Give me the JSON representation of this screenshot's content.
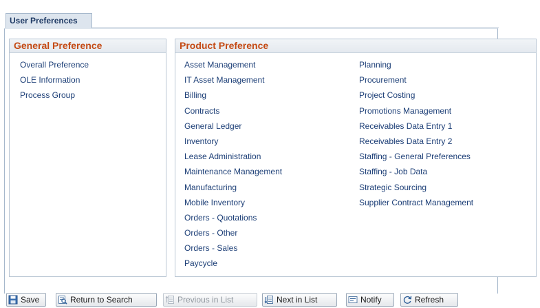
{
  "tab": {
    "label": "User Preferences"
  },
  "general": {
    "title": "General Preference",
    "links": [
      "Overall Preference",
      "OLE Information",
      "Process Group"
    ]
  },
  "product": {
    "title": "Product Preference",
    "col1": [
      "Asset Management",
      "IT Asset Management",
      "Billing",
      "Contracts",
      "General Ledger",
      "Inventory",
      "Lease Administration",
      "Maintenance Management",
      "Manufacturing",
      "Mobile Inventory",
      "Orders - Quotations",
      "Orders - Other",
      "Orders - Sales",
      "Paycycle"
    ],
    "col2": [
      "Planning",
      "Procurement",
      "Project Costing",
      "Promotions Management",
      "Receivables Data Entry 1",
      "Receivables Data Entry 2",
      "Staffing - General Preferences",
      "Staffing - Job Data",
      "Strategic Sourcing",
      "Supplier Contract Management"
    ]
  },
  "toolbar": {
    "save": "Save",
    "return_to_search": "Return to Search",
    "previous_in_list": "Previous in List",
    "next_in_list": "Next in List",
    "notify": "Notify",
    "refresh": "Refresh"
  },
  "colors": {
    "link": "#1d3f77",
    "group_title": "#c44a14",
    "tab_text": "#1f3a64"
  }
}
